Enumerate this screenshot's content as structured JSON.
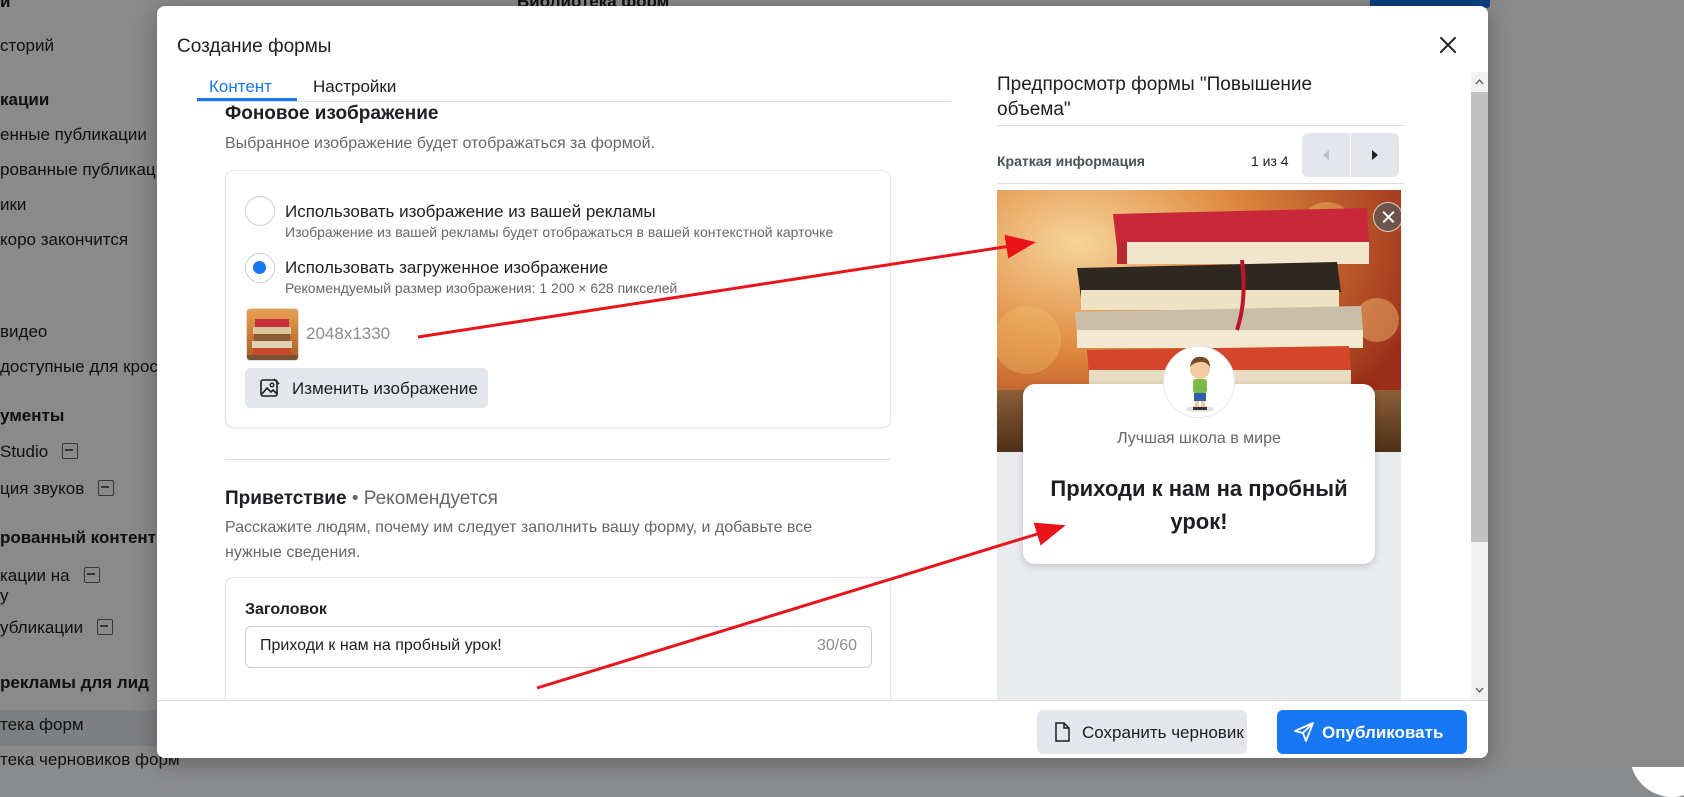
{
  "background": {
    "sidebar_items": [
      {
        "label": "и",
        "head": true
      },
      {
        "label": "сторий",
        "head": false
      },
      {
        "label": "кации",
        "head": true
      },
      {
        "label": "енные публикации",
        "head": false
      },
      {
        "label": "рованные публикац",
        "head": false
      },
      {
        "label": "ики",
        "head": false
      },
      {
        "label": "коро закончится",
        "head": false
      },
      {
        "label": "видео",
        "head": false
      },
      {
        "label": "доступные для крос",
        "head": false
      },
      {
        "label": "ументы",
        "head": true
      },
      {
        "label": "Studio",
        "head": false,
        "ext": true
      },
      {
        "label": "ция звуков",
        "head": false,
        "ext": true
      },
      {
        "label": "рованный контент",
        "head": true
      },
      {
        "label": "кации на",
        "head": false,
        "ext": true,
        "line2": "у"
      },
      {
        "label": "убликации",
        "head": false,
        "ext": true
      },
      {
        "label": "рекламы для лид",
        "head": true
      },
      {
        "label": "тека форм",
        "head": false
      },
      {
        "label": "тека черновиков форм",
        "head": false
      }
    ],
    "topbar_title": "Библиотека форм"
  },
  "modal": {
    "title": "Создание формы",
    "tabs": [
      {
        "label": "Контент",
        "active": true
      },
      {
        "label": "Настройки",
        "active": false
      }
    ],
    "background_image": {
      "title": "Фоновое изображение",
      "description": "Выбранное изображение будет отображаться за формой.",
      "options": [
        {
          "label": "Использовать изображение из вашей рекламы",
          "sub": "Изображение из вашей рекламы будет отображаться в вашей контекстной карточке",
          "checked": false
        },
        {
          "label": "Использовать загруженное изображение",
          "sub": "Рекомендуемый размер изображения:  1 200 × 628 пикселей",
          "checked": true
        }
      ],
      "image_size": "2048x1330",
      "change_button": "Изменить изображение"
    },
    "greeting": {
      "title": "Приветствие",
      "recommended": "• Рекомендуется",
      "description_line1": "Расскажите людям, почему им следует заполнить вашу форму, и добавьте все",
      "description_line2": "нужные сведения.",
      "headline_label": "Заголовок",
      "headline_value": "Приходи к нам на пробный урок!",
      "headline_counter": "30/60"
    },
    "footer": {
      "save_draft": "Сохранить черновик",
      "publish": "Опубликовать"
    },
    "preview": {
      "title": "Предпросмотр формы \"Повышение объема\"",
      "section": "Краткая информация",
      "page": "1 из 4",
      "company": "Лучшая школа в мире",
      "headline": "Приходи к нам на пробный урок!"
    }
  },
  "colors": {
    "accent": "#1877f2",
    "arrow": "#e8141a"
  },
  "icons": [
    "close-icon",
    "image-edit-icon",
    "document-icon",
    "paper-plane-icon",
    "chevron-left-icon",
    "chevron-right-icon"
  ]
}
